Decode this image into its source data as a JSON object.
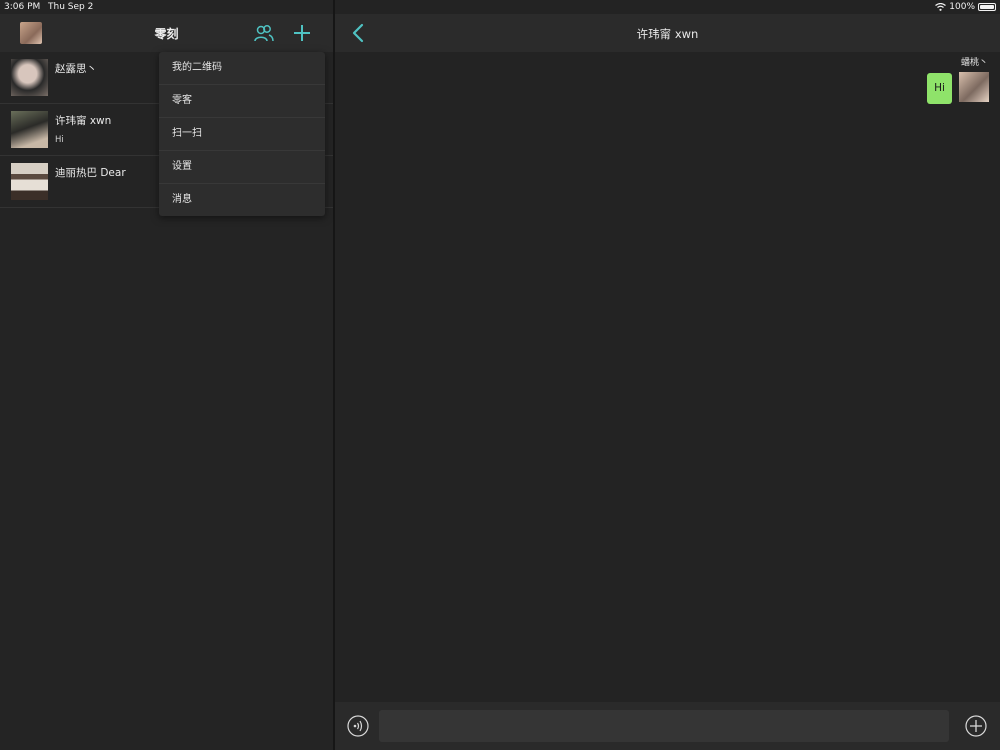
{
  "status_bar": {
    "time": "3:06 PM",
    "date": "Thu Sep 2",
    "battery": "100%"
  },
  "left": {
    "title": "零刻",
    "conversations": [
      {
        "name": "赵露思丶",
        "last_message": ""
      },
      {
        "name": "许玮甯 xwn",
        "last_message": "Hi"
      },
      {
        "name": "迪丽热巴 Dear",
        "last_message": ""
      }
    ]
  },
  "menu": {
    "items": [
      "我的二维码",
      "零客",
      "扫一扫",
      "设置",
      "消息"
    ]
  },
  "chat": {
    "title": "许玮甯 xwn",
    "messages": [
      {
        "sender": "蟠桃丶",
        "text": "Hi",
        "bubble_color": "#8fe36a"
      }
    ],
    "input_placeholder": ""
  },
  "colors": {
    "accent": "#4fc3c3",
    "background": "#1f1f1f",
    "bubble": "#8fe36a"
  },
  "icons": [
    "contacts-icon",
    "add-icon",
    "back-chevron-icon",
    "voice-icon",
    "plus-circle-icon",
    "wifi-icon",
    "battery-icon"
  ]
}
